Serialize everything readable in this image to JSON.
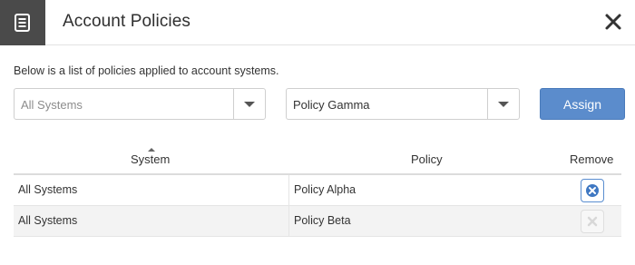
{
  "header": {
    "title": "Account Policies",
    "icon": "document-list-icon",
    "close_icon": "close-icon"
  },
  "description": "Below is a list of policies applied to account systems.",
  "system_select": {
    "value": "All Systems"
  },
  "policy_select": {
    "value": "Policy Gamma"
  },
  "assign_label": "Assign",
  "table": {
    "columns": [
      "System",
      "Policy",
      "Remove"
    ],
    "sorted_column": "System",
    "rows": [
      {
        "system": "All Systems",
        "policy": "Policy Alpha",
        "remove_enabled": true
      },
      {
        "system": "All Systems",
        "policy": "Policy Beta",
        "remove_enabled": false
      }
    ]
  },
  "colors": {
    "header_icon_bg": "#4a4a4a",
    "accent": "#5b8ccc",
    "remove_icon": "#3f78c2"
  }
}
